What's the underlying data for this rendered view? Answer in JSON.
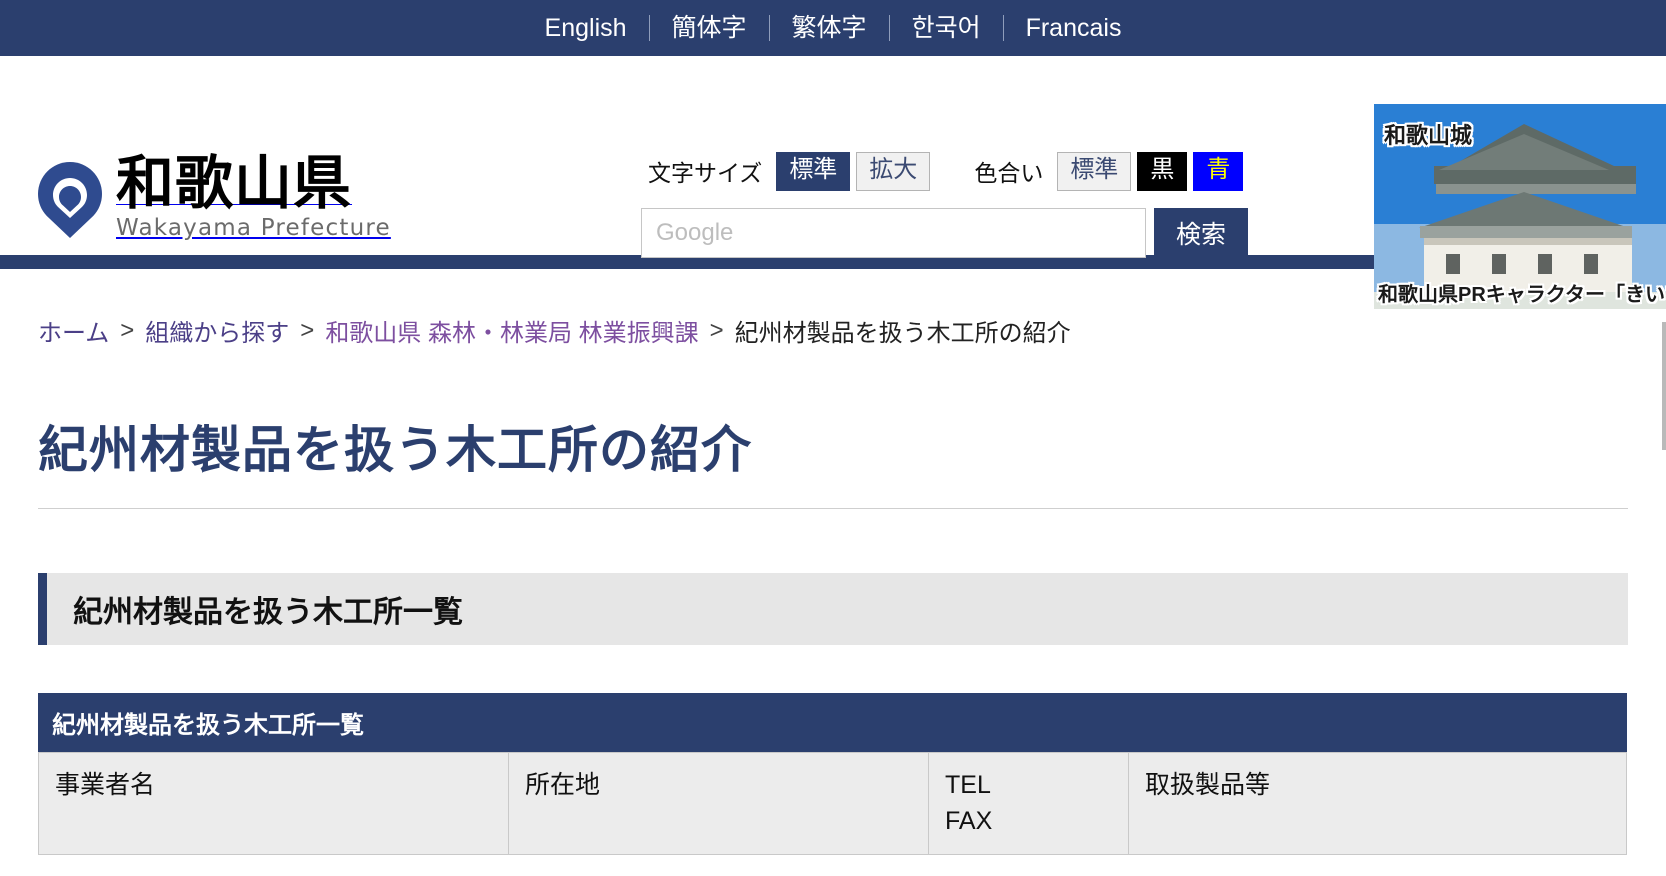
{
  "language_bar": {
    "items": [
      {
        "label": "English"
      },
      {
        "label": "簡体字"
      },
      {
        "label": "繁体字"
      },
      {
        "label": "한국어"
      },
      {
        "label": "Francais"
      }
    ]
  },
  "header": {
    "logo": {
      "icon": "wakayama-prefecture-mark",
      "title": "和歌山県",
      "subtitle": "Wakayama Prefecture"
    },
    "text_size": {
      "label": "文字サイズ",
      "options": [
        {
          "label": "標準",
          "selected": true
        },
        {
          "label": "拡大",
          "selected": false
        }
      ]
    },
    "color_scheme": {
      "label": "色合い",
      "options": [
        {
          "label": "標準",
          "style": "default"
        },
        {
          "label": "黒",
          "style": "black"
        },
        {
          "label": "青",
          "style": "blue"
        }
      ]
    },
    "search": {
      "placeholder": "Google",
      "value": "",
      "button_label": "検索"
    },
    "banner": {
      "top_caption": "和歌山城",
      "bottom_caption": "和歌山県PRキャラクター「きいち"
    }
  },
  "breadcrumb": {
    "items": [
      {
        "label": "ホーム",
        "type": "link"
      },
      {
        "label": "組織から探す",
        "type": "link"
      },
      {
        "label": "和歌山県 森林・林業局 林業振興課",
        "type": "visited-link"
      },
      {
        "label": "紀州材製品を扱う木工所の紹介",
        "type": "current"
      }
    ],
    "separator": ">"
  },
  "main": {
    "page_title": "紀州材製品を扱う木工所の紹介",
    "section_heading": "紀州材製品を扱う木工所一覧",
    "table": {
      "caption": "紀州材製品を扱う木工所一覧",
      "columns": [
        {
          "label": "事業者名"
        },
        {
          "label": "所在地"
        },
        {
          "label": "TEL\nFAX"
        },
        {
          "label": "取扱製品等"
        }
      ],
      "rows": []
    }
  },
  "colors": {
    "brand_navy": "#2b3f6e",
    "language_bar_bg": "#2b3f6e",
    "section_bg": "#e6e6e6",
    "table_header_bg": "#ececec",
    "link": "#4b3f87",
    "visited_link": "#7d4fa0",
    "blue_scheme": "#0000ff",
    "blue_scheme_text": "#ffff00"
  }
}
